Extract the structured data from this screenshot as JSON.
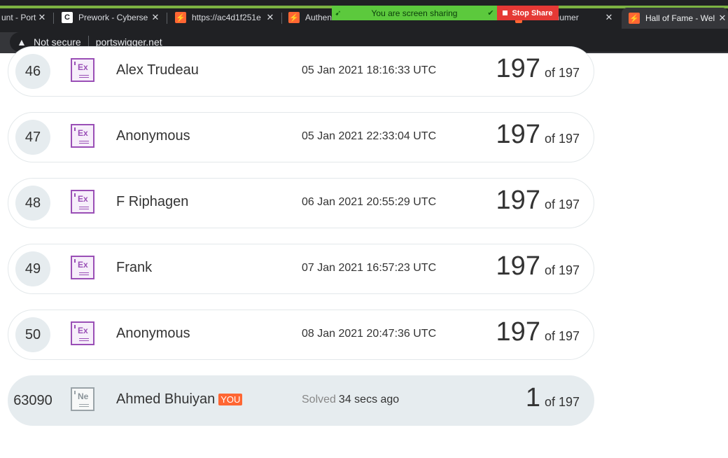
{
  "browser": {
    "tabs": [
      {
        "title": "unt - Port",
        "icon": "portswigger-icon",
        "favicon_text": "",
        "active": false
      },
      {
        "title": "Prework - Cyberse",
        "icon": "c-site-icon",
        "favicon_text": "C",
        "active": false
      },
      {
        "title": "https://ac4d1f251e",
        "icon": "portswigger-icon",
        "favicon_text": "",
        "active": false
      },
      {
        "title": "Authen",
        "icon": "portswigger-icon",
        "favicon_text": "",
        "active": false
      },
      {
        "title": "me enumer",
        "icon": "portswigger-icon",
        "favicon_text": "",
        "active": false
      },
      {
        "title": "Hall of Fame - Wel",
        "icon": "portswigger-icon",
        "favicon_text": "",
        "active": true
      }
    ],
    "screen_share": {
      "label": "You are screen sharing",
      "stop_label": "Stop Share"
    },
    "omnibox": {
      "security_label": "Not secure",
      "host": "portswigger.net"
    }
  },
  "leaderboard": {
    "rows": [
      {
        "rank": "46",
        "badge": "Ex",
        "name": "Alex Trudeau",
        "prefix": "",
        "date": "05 Jan 2021 18:16:33 UTC",
        "score": "197",
        "total": "of 197",
        "you_tag": ""
      },
      {
        "rank": "47",
        "badge": "Ex",
        "name": "Anonymous",
        "prefix": "",
        "date": "05 Jan 2021 22:33:04 UTC",
        "score": "197",
        "total": "of 197",
        "you_tag": ""
      },
      {
        "rank": "48",
        "badge": "Ex",
        "name": "F Riphagen",
        "prefix": "",
        "date": "06 Jan 2021 20:55:29 UTC",
        "score": "197",
        "total": "of 197",
        "you_tag": ""
      },
      {
        "rank": "49",
        "badge": "Ex",
        "name": "Frank",
        "prefix": "",
        "date": "07 Jan 2021 16:57:23 UTC",
        "score": "197",
        "total": "of 197",
        "you_tag": ""
      },
      {
        "rank": "50",
        "badge": "Ex",
        "name": "Anonymous",
        "prefix": "",
        "date": "08 Jan 2021 20:47:36 UTC",
        "score": "197",
        "total": "of 197",
        "you_tag": ""
      },
      {
        "rank": "63090",
        "badge": "Ne",
        "name": "Ahmed Bhuiyan",
        "prefix": "Solved",
        "date": "34 secs ago",
        "score": "1",
        "total": "of 197",
        "you_tag": "YOU"
      }
    ]
  },
  "colors": {
    "expert_badge": "#9a4fb6",
    "novice_badge": "#9aa3a8",
    "you_tag": "#ff6633",
    "share_bar": "#5cc93d",
    "stop_share": "#e53935"
  }
}
